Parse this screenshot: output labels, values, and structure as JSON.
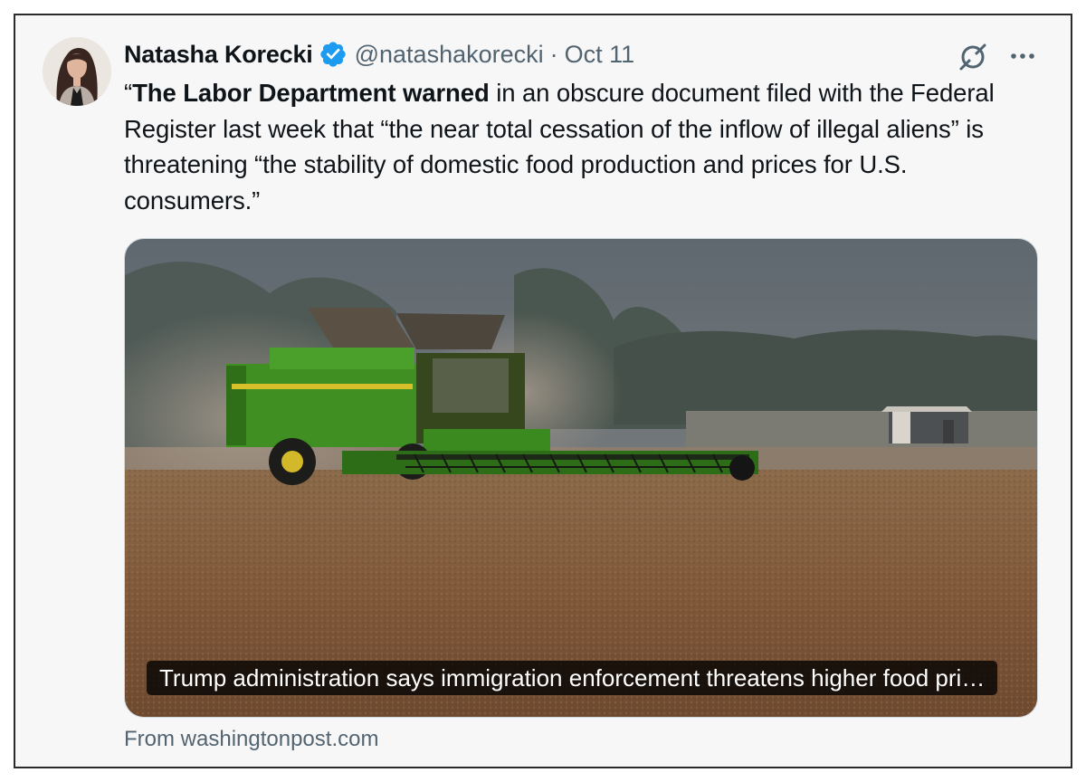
{
  "post": {
    "author": {
      "display_name": "Natasha Korecki",
      "handle": "@natashakorecki",
      "verified": true,
      "verified_color": "#1d9bf0",
      "avatar_icon": "author-avatar"
    },
    "separator": "·",
    "date": "Oct 11",
    "text": {
      "open_quote": "“",
      "bold": "The Labor Department warned",
      "rest": " in an obscure document filed with the Federal Register last week that “the near total cessation of the inflow of illegal aliens” is threatening “the stability of domestic food production and prices for U.S. consumers.”"
    },
    "link_card": {
      "image_icon": "combine-harvester-field-photo",
      "title": "Trump administration says immigration enforcement threatens higher food pri…",
      "source": "From washingtonpost.com"
    },
    "actions": {
      "grok_icon": "grok-icon",
      "more_icon": "more-options-icon"
    }
  }
}
